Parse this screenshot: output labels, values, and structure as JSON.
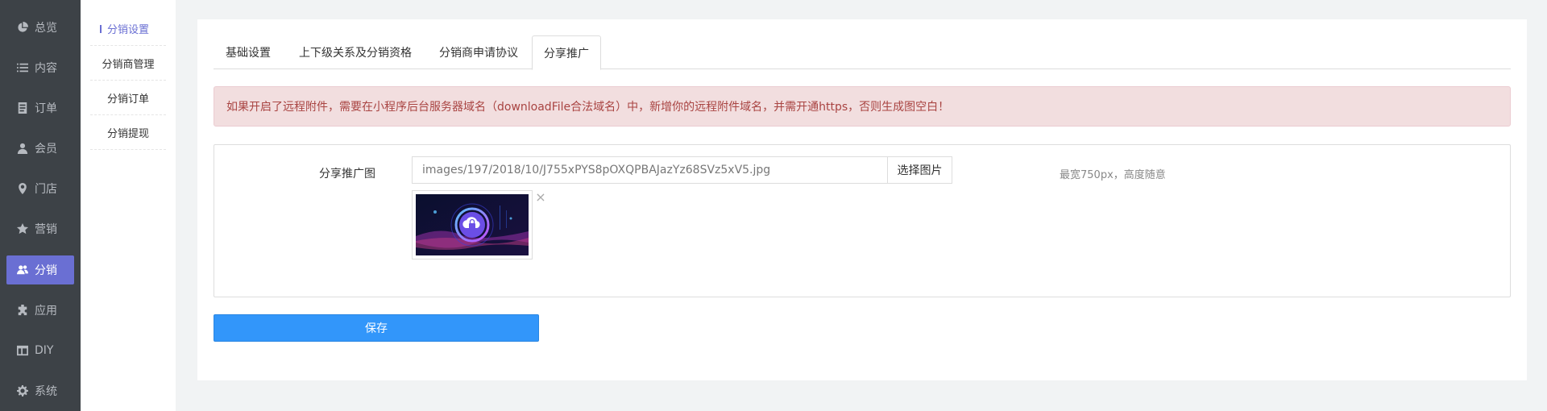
{
  "nav": {
    "items": [
      {
        "label": "总览",
        "icon": "pie-chart-icon"
      },
      {
        "label": "内容",
        "icon": "list-icon"
      },
      {
        "label": "订单",
        "icon": "document-icon"
      },
      {
        "label": "会员",
        "icon": "user-icon"
      },
      {
        "label": "门店",
        "icon": "map-pin-icon"
      },
      {
        "label": "营销",
        "icon": "star-icon"
      },
      {
        "label": "分销",
        "icon": "users-icon",
        "active": true
      },
      {
        "label": "应用",
        "icon": "puzzle-icon"
      },
      {
        "label": "DIY",
        "icon": "layout-icon"
      },
      {
        "label": "系统",
        "icon": "gear-icon"
      }
    ]
  },
  "subnav": {
    "items": [
      {
        "label": "分销设置",
        "active": true
      },
      {
        "label": "分销商管理"
      },
      {
        "label": "分销订单"
      },
      {
        "label": "分销提现"
      }
    ]
  },
  "tabs": [
    {
      "label": "基础设置"
    },
    {
      "label": "上下级关系及分销资格"
    },
    {
      "label": "分销商申请协议"
    },
    {
      "label": "分享推广",
      "active": true
    }
  ],
  "alert": {
    "text": "如果开启了远程附件，需要在小程序后台服务器域名（downloadFile合法域名）中，新增你的远程附件域名，并需开通https，否则生成图空白！"
  },
  "form": {
    "share_image": {
      "label": "分享推广图",
      "value": "images/197/2018/10/J755xPYS8pOXQPBAJazYz68SVz5xV5.jpg",
      "button_label": "选择图片",
      "hint": "最宽750px，高度随意",
      "remove_symbol": "×"
    }
  },
  "actions": {
    "save_label": "保存"
  },
  "colors": {
    "nav_bg": "#3d4247",
    "nav_active": "#6a6fd3",
    "primary_button": "#3296fa",
    "alert_bg": "#f2dedf",
    "alert_text": "#a94442"
  }
}
